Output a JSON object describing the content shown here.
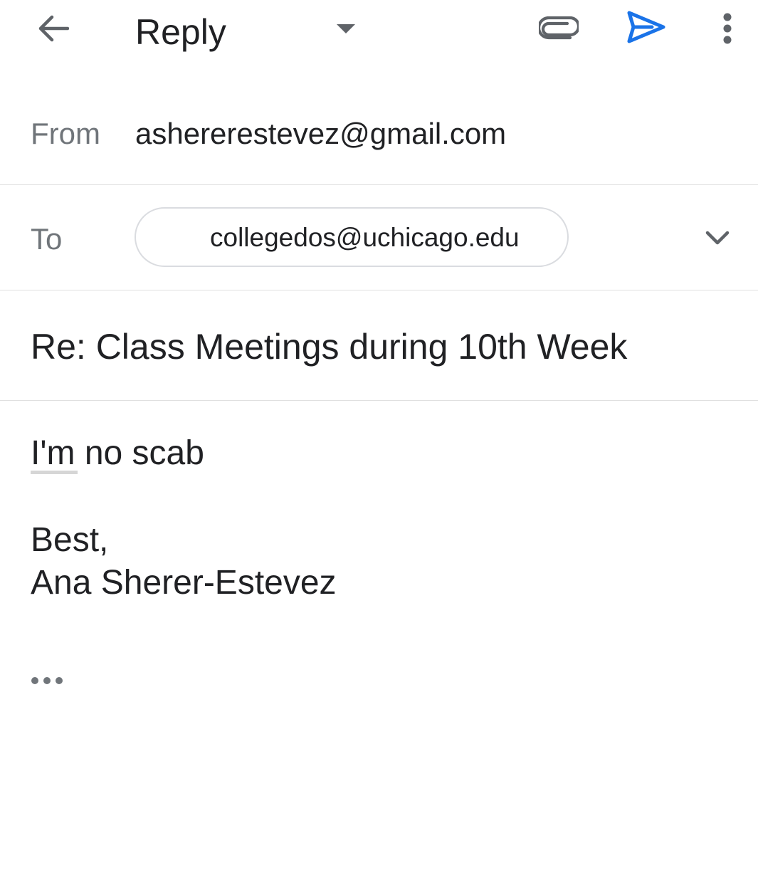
{
  "header": {
    "title": "Reply",
    "icons": {
      "back": "arrow-back-icon",
      "mode_dropdown": "caret-down-icon",
      "attach": "paperclip-icon",
      "send": "send-icon",
      "more": "more-vertical-icon"
    },
    "send_color": "#1a73e8",
    "icon_color": "#5f6368"
  },
  "from": {
    "label": "From",
    "value": "ashererestevez@gmail.com"
  },
  "to": {
    "label": "To",
    "recipients": [
      "collegedos@uchicago.edu"
    ],
    "expand_icon": "chevron-down-icon"
  },
  "subject": "Re: Class Meetings during 10th Week",
  "body": {
    "lines": [
      "I'm no scab",
      "Best,",
      "Ana Sherer-Estevez"
    ],
    "quoted_toggle_icon": "more-horizontal-icon"
  }
}
